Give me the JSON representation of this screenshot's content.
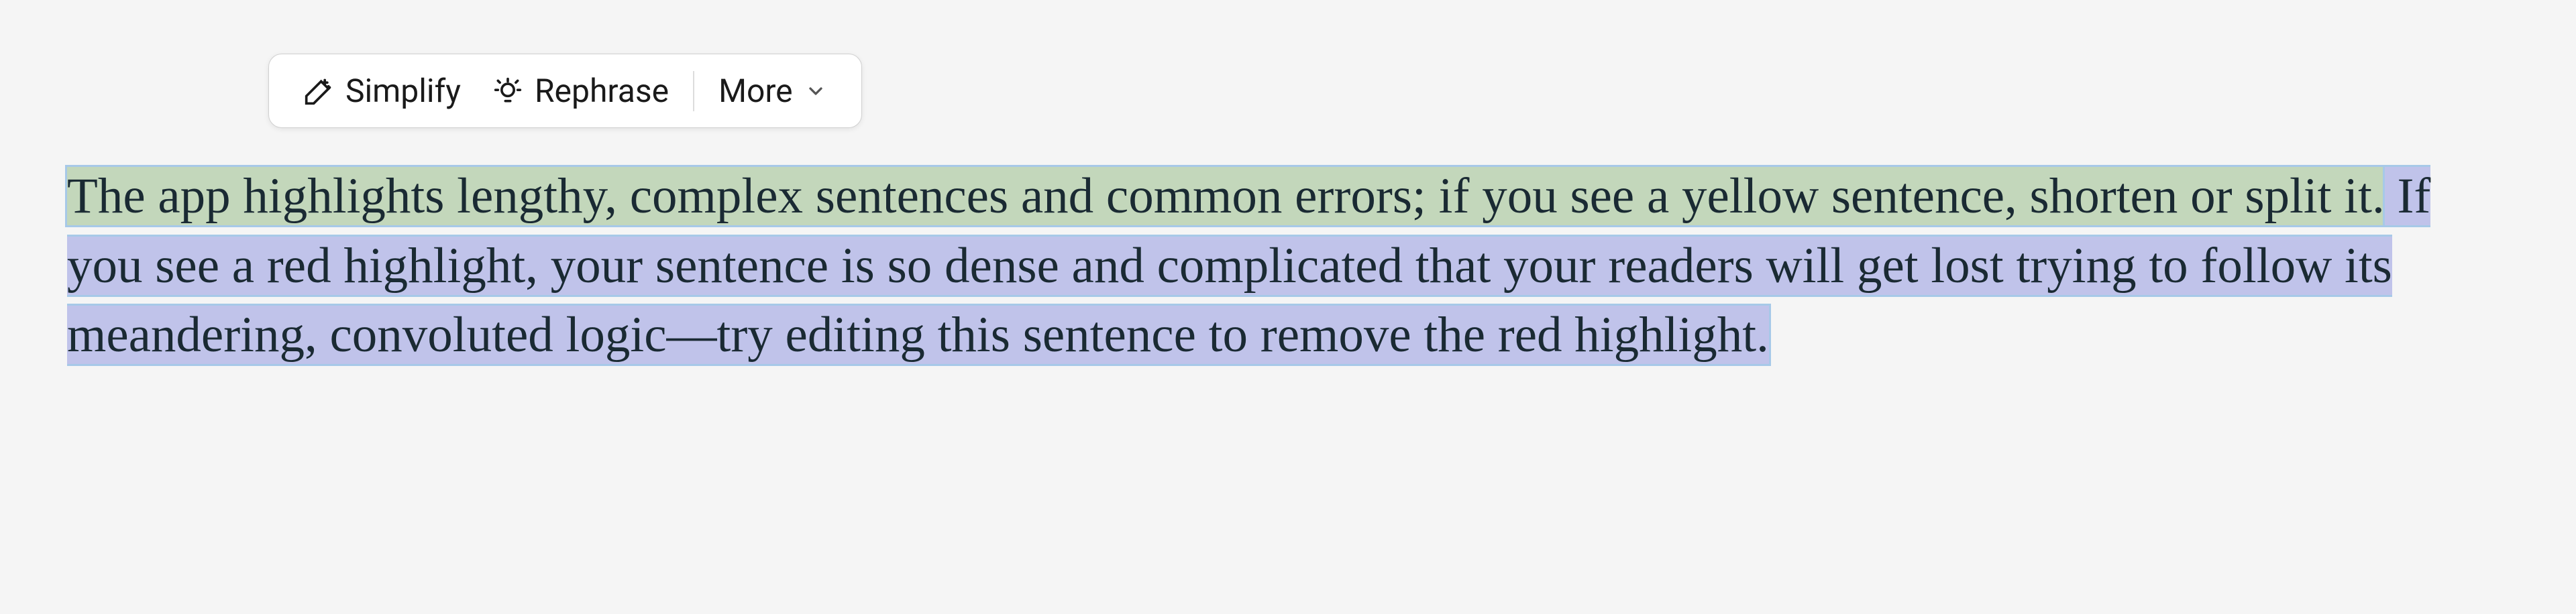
{
  "toolbar": {
    "simplify_label": "Simplify",
    "rephrase_label": "Rephrase",
    "more_label": "More"
  },
  "text": {
    "sentence_1": "The app highlights lengthy, complex sentences and common errors; if you see a yellow sentence, shorten or split it.",
    "sentence_2": " If you see a red highlight, your sentence is so dense and complicated that your readers will get lost trying to follow its meandering, convoluted logic—try editing this sentence to remove the red highlight."
  },
  "colors": {
    "highlight_green": "#c3d7bb",
    "highlight_purple": "#c0c3ea",
    "selection_outline": "#a7c9e8"
  }
}
